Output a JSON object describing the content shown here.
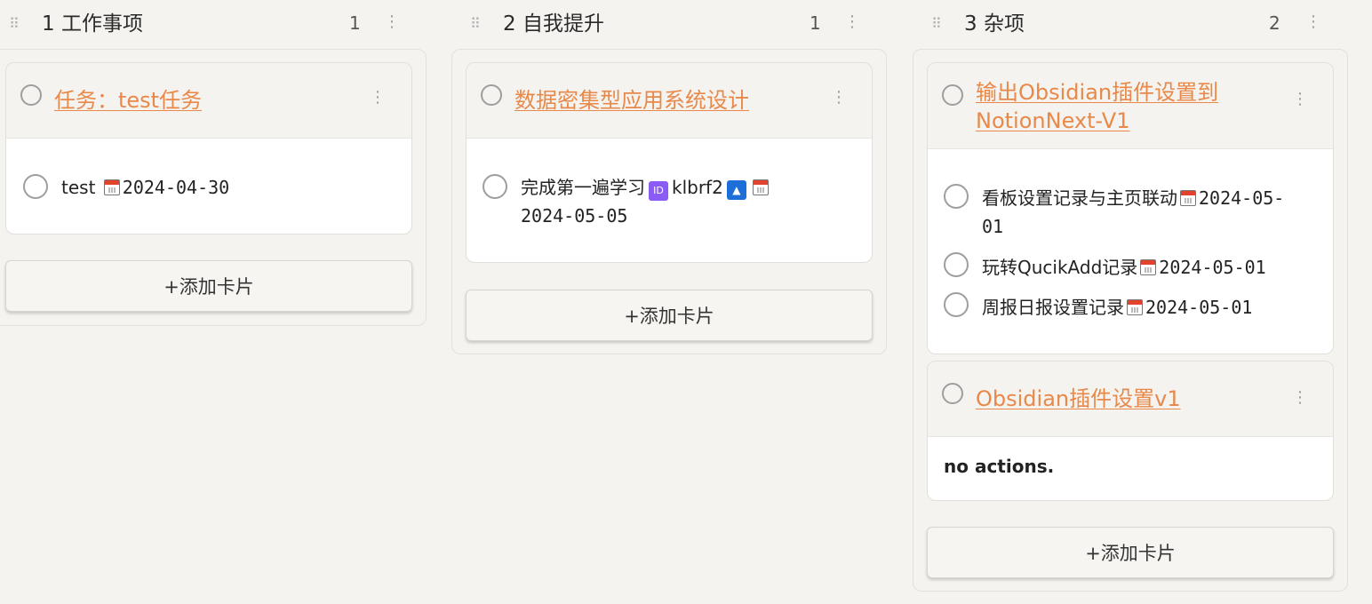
{
  "lanes": [
    {
      "title": "1 工作事项",
      "count": "1",
      "cards": [
        {
          "title": "任务：test任务",
          "tasks": [
            {
              "text": "test",
              "date": "2024-04-30"
            }
          ]
        }
      ],
      "add_label": "+添加卡片"
    },
    {
      "title": "2 自我提升",
      "count": "1",
      "cards": [
        {
          "title": "数据密集型应用系统设计",
          "tasks": [
            {
              "text": "完成第一遍学习",
              "id_badge": "ID",
              "id": "klbrf2",
              "priority_badge": "▲",
              "date": "2024-05-05"
            }
          ]
        }
      ],
      "add_label": "+添加卡片"
    },
    {
      "title": "3 杂项",
      "count": "2",
      "cards": [
        {
          "title_line1": "输出Obsidian插件设置到",
          "title_line2": "NotionNext-V1",
          "tasks": [
            {
              "text": "看板设置记录与主页联动",
              "date_line1": "2024-05-",
              "date_line2": "01"
            },
            {
              "text": "玩转QucikAdd记录",
              "date": "2024-05-01"
            },
            {
              "text": "周报日报设置记录",
              "date": "2024-05-01"
            }
          ]
        },
        {
          "title": "Obsidian插件设置v1",
          "empty_text": "no actions."
        }
      ],
      "add_label": "+添加卡片"
    }
  ],
  "icons": {
    "drag": "drag-handle-icon",
    "menu": "more-vertical-icon",
    "calendar": "calendar-icon",
    "circle": "task-checkbox"
  },
  "colors": {
    "accent": "#e8894a",
    "background": "#f4f3ef",
    "id_badge": "#8a5cf5",
    "priority_badge": "#1c6fd9"
  }
}
